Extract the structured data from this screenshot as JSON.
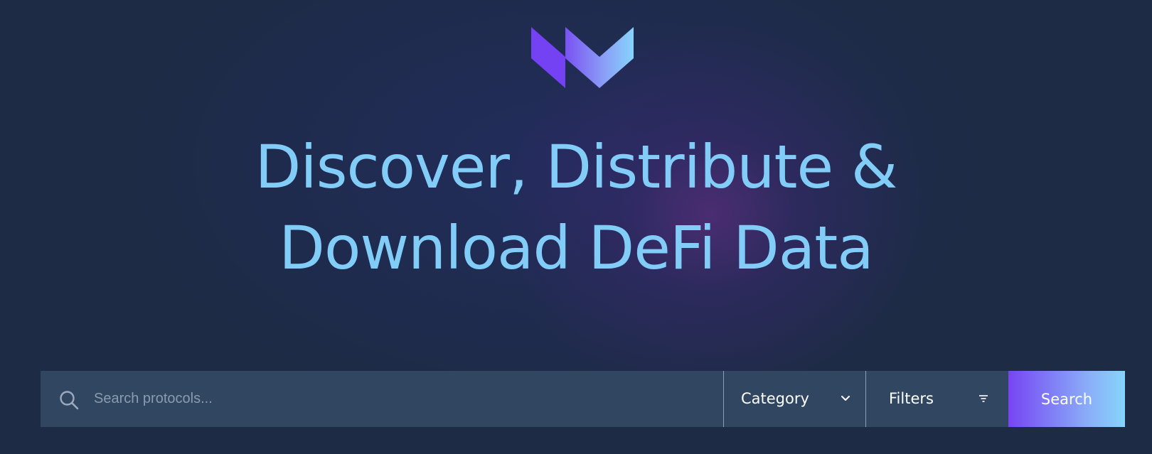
{
  "brand": {
    "logo_icon": "brand-logo-icon",
    "colors": {
      "purple": "#7645f3",
      "light_blue": "#86d4fb",
      "headline": "#82cdf8",
      "background": "#1d2b45",
      "searchbar": "#314660"
    }
  },
  "hero": {
    "headline_line1": "Discover, Distribute &",
    "headline_line2": "Download DeFi Data"
  },
  "search": {
    "placeholder": "Search protocols...",
    "value": "",
    "icon": "search-icon",
    "category_label": "Category",
    "category_icon": "chevron-down-icon",
    "filters_label": "Filters",
    "filters_icon": "filter-icon",
    "button_label": "Search"
  }
}
